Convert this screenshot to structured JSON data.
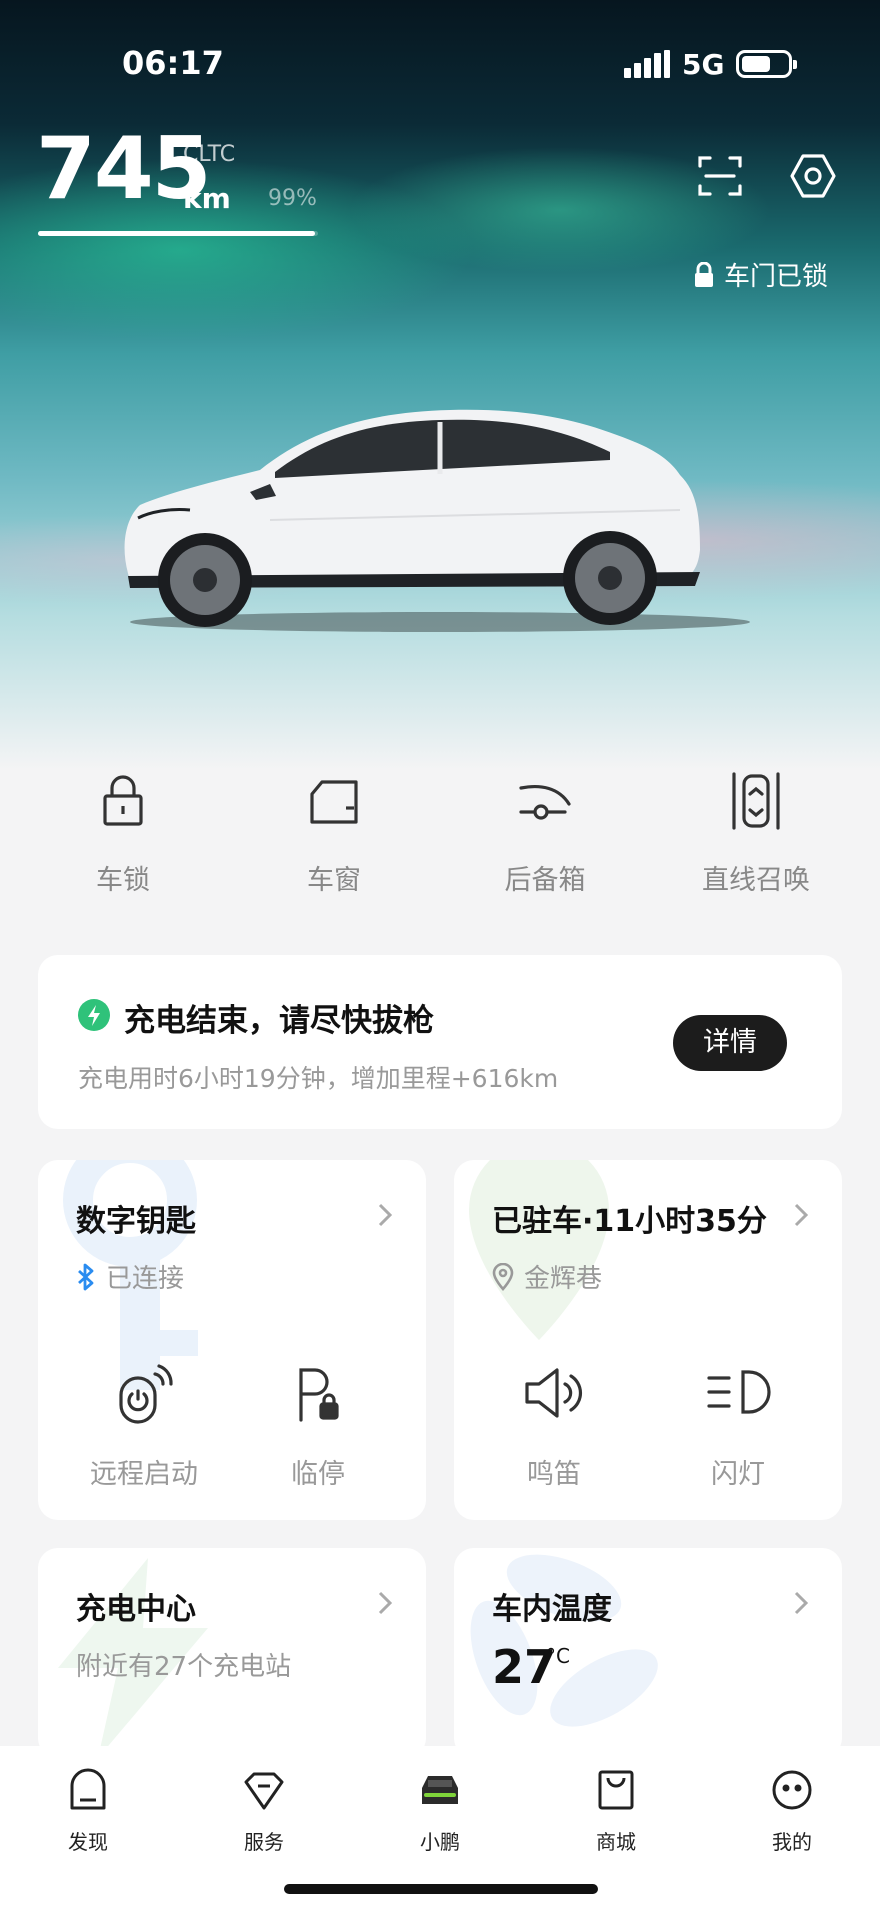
{
  "status_bar": {
    "time": "06:17",
    "network": "5G"
  },
  "range": {
    "value": "745",
    "standard": "CLTC",
    "unit": "km",
    "battery_percent": "99%",
    "battery_fraction": 0.99
  },
  "vehicle": {
    "lock_status": "车门已锁"
  },
  "quick_actions": [
    {
      "label": "车锁",
      "icon": "lock-icon"
    },
    {
      "label": "车窗",
      "icon": "window-icon"
    },
    {
      "label": "后备箱",
      "icon": "trunk-icon"
    },
    {
      "label": "直线召唤",
      "icon": "summon-icon"
    }
  ],
  "charge_notice": {
    "title": "充电结束，请尽快拔枪",
    "subtitle": "充电用时6小时19分钟，增加里程+616km",
    "button": "详情"
  },
  "digital_key": {
    "title": "数字钥匙",
    "status": "已连接",
    "actions": [
      {
        "label": "远程启动",
        "icon": "remote-start-icon"
      },
      {
        "label": "临停",
        "icon": "temp-parking-icon"
      }
    ]
  },
  "parking": {
    "title": "已驻车·11小时35分",
    "location": "金辉巷",
    "actions": [
      {
        "label": "鸣笛",
        "icon": "horn-icon"
      },
      {
        "label": "闪灯",
        "icon": "flash-light-icon"
      }
    ]
  },
  "charging_center": {
    "title": "充电中心",
    "subtitle": "附近有27个充电站"
  },
  "cabin_temp": {
    "title": "车内温度",
    "value": "27",
    "unit": "°C"
  },
  "tab_bar": [
    {
      "label": "发现",
      "icon": "discover-icon"
    },
    {
      "label": "服务",
      "icon": "service-icon"
    },
    {
      "label": "小鹏",
      "icon": "car-icon",
      "active": true
    },
    {
      "label": "商城",
      "icon": "mall-icon"
    },
    {
      "label": "我的",
      "icon": "profile-icon"
    }
  ],
  "colors": {
    "charge_green": "#2fc27a",
    "bluetooth_blue": "#2a8cf0",
    "active_tab_accent": "#7fd43a"
  }
}
